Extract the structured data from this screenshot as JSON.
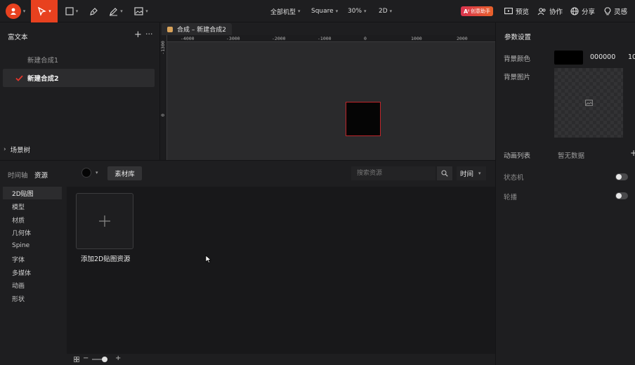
{
  "toolbar": {
    "tools": [
      {
        "name": "logo"
      },
      {
        "name": "select-tool"
      },
      {
        "name": "rectangle-tool"
      },
      {
        "name": "pen-tool"
      },
      {
        "name": "brush-tool"
      },
      {
        "name": "image-tool"
      }
    ],
    "device_model": "全部机型",
    "shape": "Square",
    "zoom": "30%",
    "view_mode": "2D",
    "badge": "创意助手",
    "preview": "预览",
    "collaborate": "协作",
    "share": "分享",
    "inspiration": "灵感"
  },
  "left_panel": {
    "title": "富文本",
    "compositions": [
      "新建合成1",
      "新建合成2"
    ],
    "selected_index": 1,
    "scene_tree": "场景树"
  },
  "canvas": {
    "tab_label": "合成 – 新建合成2",
    "ruler_x": [
      "-4000",
      "-3000",
      "-2000",
      "-1000",
      "0",
      "1000",
      "2000"
    ],
    "ruler_y": [
      "-1300",
      "0"
    ]
  },
  "right_panel": {
    "title": "参数设置",
    "bg_color_label": "背景颜色",
    "bg_color_value": "000000",
    "bg_color_extra": "10",
    "bg_image_label": "背景图片",
    "animation_list_label": "动画列表",
    "animation_list_value": "暂无数据",
    "state_machine_label": "状态机",
    "carousel_label": "轮播",
    "colors": {
      "swatch": "#000000"
    }
  },
  "bottom_panel": {
    "timeline_tab": "时间轴",
    "resources_tab": "资源",
    "library_button": "素材库",
    "search_placeholder": "搜索资源",
    "sort_label": "时间",
    "categories": [
      "2D贴图",
      "模型",
      "材质",
      "几何体",
      "Spine",
      "字体",
      "多媒体",
      "动画",
      "形状"
    ],
    "selected_category": 0,
    "add_tile_label": "添加2D贴图资源"
  },
  "colors": {
    "accent": "#e8411f",
    "selection_border": "#c0252a",
    "check": "#e5352b"
  }
}
